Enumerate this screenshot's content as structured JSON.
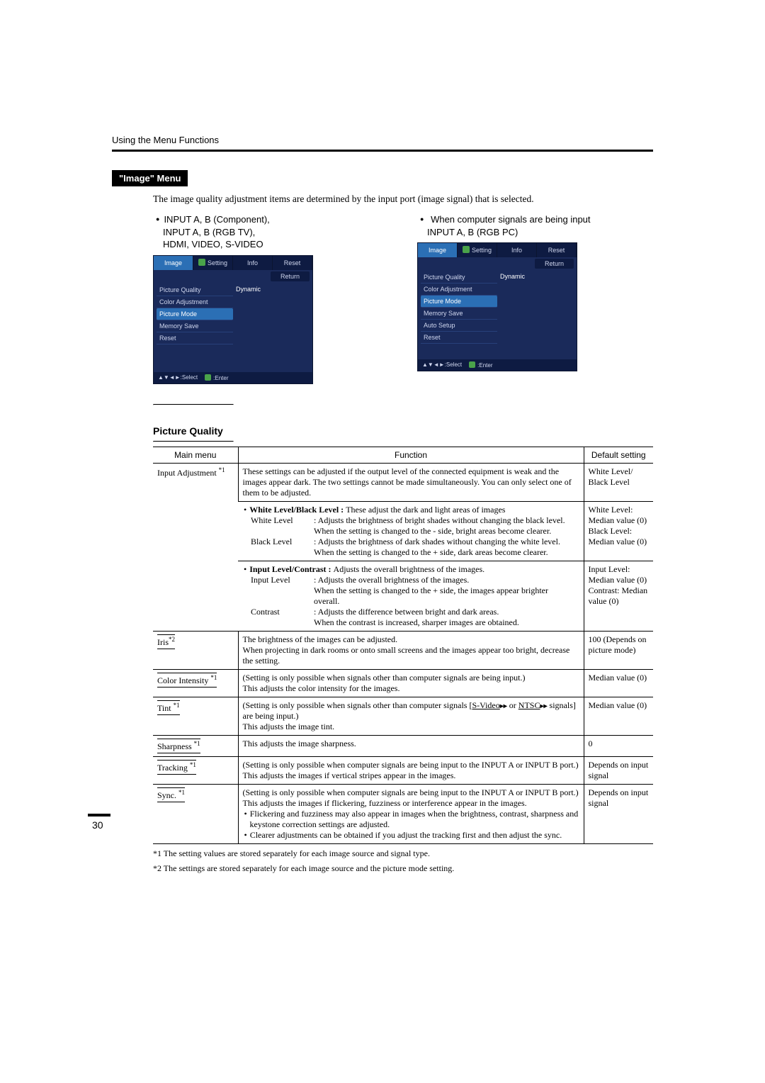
{
  "page_header": "Using the Menu Functions",
  "section_title": "\"Image\" Menu",
  "intro": "The image quality adjustment items are determined by the input port (image signal) that is selected.",
  "columns": {
    "left_label": "INPUT A, B (Component),\nINPUT A, B (RGB TV),\nHDMI, VIDEO, S-VIDEO",
    "right_label_head": "When computer signals are being input",
    "right_label_sub": "INPUT A, B (RGB PC)"
  },
  "osd": {
    "tabs": {
      "image": "Image",
      "settings": "Setting",
      "info": "Info",
      "reset": "Reset"
    },
    "return": "Return",
    "value": "Dynamic",
    "footer_select": "▲▼◄►:Select",
    "footer_enter": ":Enter",
    "left_items": [
      "Picture Quality",
      "Color Adjustment",
      "Picture Mode",
      "Memory Save",
      "Reset"
    ],
    "right_items": [
      "Picture Quality",
      "Color Adjustment",
      "Picture Mode",
      "Memory Save",
      "Auto Setup",
      "Reset"
    ]
  },
  "subsection_title": "Picture Quality",
  "table": {
    "headers": {
      "main": "Main menu",
      "function": "Function",
      "default": "Default setting"
    },
    "rows": {
      "input_adjustment": {
        "main": "Input Adjustment",
        "main_sup": "*1",
        "func_intro": "These settings can be adjusted if the output level of the connected equipment is weak and the images appear dark. The two settings cannot be made simultaneously. You can only select one of them to be adjusted.",
        "wb_head": "White Level/Black Level : ",
        "wb_head_rest": "These adjust the dark and light areas of images",
        "white_term": "White Level",
        "white_body_l1": ": Adjusts the brightness of bright shades without changing the black level.",
        "white_body_l2": "When the setting is changed to the - side, bright areas become clearer.",
        "black_term": "Black Level",
        "black_body_l1": ": Adjusts the brightness of dark shades without changing the white level.",
        "black_body_l2": "When the setting is changed to the + side, dark areas become clearer.",
        "ic_head": "Input Level/Contrast : ",
        "ic_head_rest": "Adjusts the overall brightness of the images.",
        "input_term": "Input Level",
        "input_body_l1": ": Adjusts the overall brightness of the images.",
        "input_body_l2": "When the setting is changed to the + side, the images appear brighter overall.",
        "contrast_term": "Contrast",
        "contrast_body_l1": ": Adjusts the difference between bright and dark areas.",
        "contrast_body_l2": "When the contrast is increased, sharper images are obtained.",
        "default_top": "White Level/ Black Level",
        "default_wb": "White Level: Median value (0)\nBlack Level: Median value (0)",
        "default_ic": "Input Level: Median value (0)\nContrast: Median value (0)"
      },
      "iris": {
        "main": "Iris",
        "main_sup": "*2",
        "func": "The brightness of the images can be adjusted.\nWhen projecting in dark rooms or onto small screens and the images appear too bright, decrease the setting.",
        "default": "100 (Depends on picture mode)"
      },
      "color_intensity": {
        "main": "Color Intensity",
        "main_sup": "*1",
        "func": "(Setting is only possible when signals other than computer signals are being input.)\nThis adjusts the color intensity for the images.",
        "default": "Median value (0)"
      },
      "tint": {
        "main": "Tint",
        "main_sup": "*1",
        "func_pre": "(Setting is only possible when signals other than computer signals [",
        "func_svideo": "S-Video",
        "func_mid": " or ",
        "func_ntsc": "NTSC",
        "func_post": " signals] are being input.)\nThis adjusts the image tint.",
        "default": "Median value (0)"
      },
      "sharpness": {
        "main": "Sharpness",
        "main_sup": "*1",
        "func": "This adjusts the image sharpness.",
        "default": "0"
      },
      "tracking": {
        "main": "Tracking",
        "main_sup": "*1",
        "func": "(Setting is only possible when computer signals are being input to the INPUT A or INPUT B port.)\nThis adjusts the images if vertical stripes appear in the images.",
        "default": "Depends on input signal"
      },
      "sync": {
        "main": "Sync.",
        "main_sup": "*1",
        "func_l1": "(Setting is only possible when computer signals are being input to the INPUT A or INPUT B port.)",
        "func_l2": "This adjusts the images if flickering, fuzziness or interference appear in the images.",
        "func_b1": "Flickering and fuzziness may also appear in images when the brightness, contrast, sharpness and keystone correction settings are adjusted.",
        "func_b2": "Clearer adjustments can be obtained if you adjust the tracking first and then adjust the sync.",
        "default": "Depends on input signal"
      }
    }
  },
  "footnotes": {
    "n1": "*1 The setting values are stored separately for each image source and signal type.",
    "n2": "*2 The settings are stored separately for each image source and the picture mode setting."
  },
  "page_number": "30"
}
